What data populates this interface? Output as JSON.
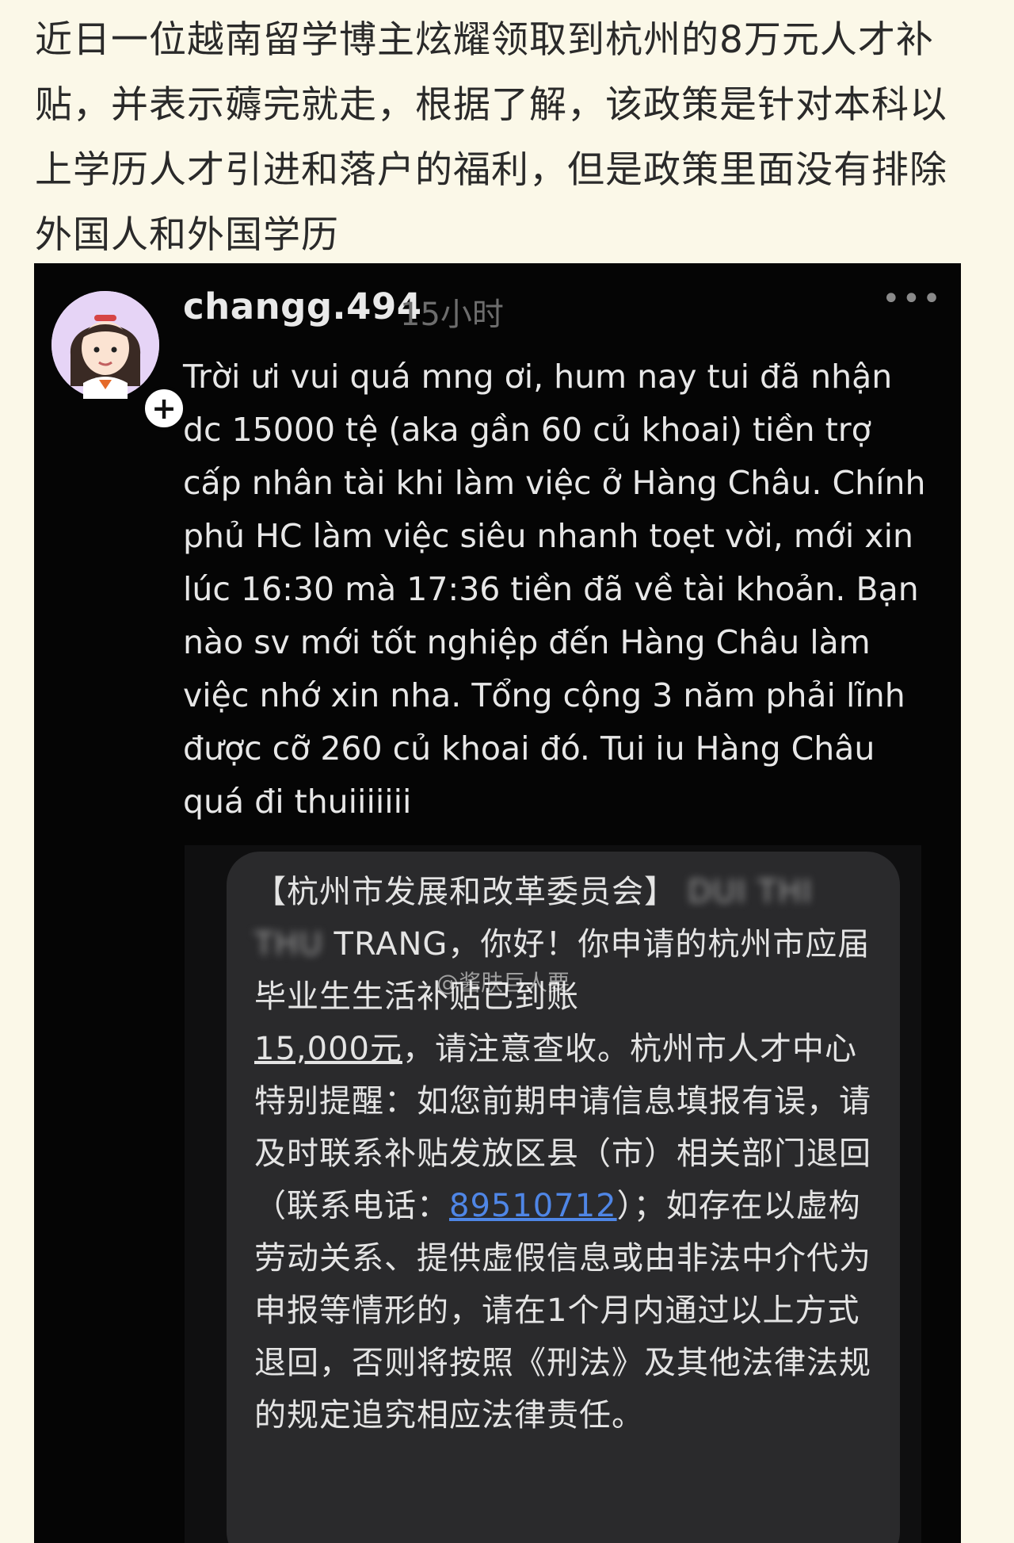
{
  "caption": "近日一位越南留学博主炫耀领取到杭州的8万元人才补贴，并表示薅完就走，根据了解，该政策是针对本科以上学历人才引进和落户的福利，但是政策里面没有排除外国人和外国学历",
  "post": {
    "username": "changg.494",
    "timestamp": "15小时",
    "more_icon": "more-icon",
    "avatar_icon": "avatar-icon",
    "add_icon": "plus-icon",
    "text": "Trời ưi vui quá mng ơi, hum nay tui đã nhận dc 15000 tệ (aka gần 60 củ khoai) tiền trợ cấp nhân tài khi làm việc ở Hàng Châu. Chính phủ HC làm việc siêu nhanh toẹt vời, mới xin lúc 16:30 mà 17:36 tiền đã về tài khoản. Bạn nào sv mới tốt nghiệp đến Hàng Châu làm việc nhớ xin nha. Tổng cộng 3 năm phải lĩnh được cỡ 260 củ khoai đó. Tui iu Hàng Châu quá đi thuiiiiiii"
  },
  "sms": {
    "sender": "【杭州市发展和改革委员会】",
    "blurred_name_1": "DUI THI",
    "blurred_name_2": "THU",
    "greeting": " TRANG，你好！你申请的杭州市应届毕业生生活补贴已到账",
    "amount": "15,000元",
    "body_1": "，请注意查收。杭州市人才中心特别提醒：如您前期申请信息填报有误，请及时联系补贴发放区县（市）相关部门退回（联系电话：",
    "phone": "89510712",
    "body_2": "）；如存在以虚构劳动关系、提供虚假信息或由非法中介代为申报等情形的，请在1个月内通过以上方式退回，否则将按照《刑法》及其他法律法规的规定追究相应法律责任。"
  },
  "watermark": "@酱肤巨人要"
}
